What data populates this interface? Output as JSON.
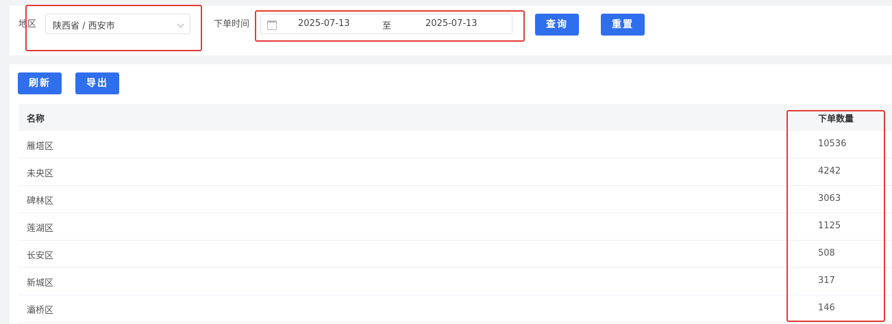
{
  "filters": {
    "region_label": "地区",
    "region_value": "陕西省 / 西安市",
    "order_time_label": "下单时间",
    "date_start": "2025-07-13",
    "date_separator": "至",
    "date_end": "2025-07-13",
    "query_button": "查询",
    "reset_button": "重置"
  },
  "toolbar": {
    "refresh_button": "刷新",
    "export_button": "导出"
  },
  "table": {
    "columns": [
      "名称",
      "下单数量"
    ],
    "rows": [
      {
        "name": "雁塔区",
        "count": "10536"
      },
      {
        "name": "未央区",
        "count": "4242"
      },
      {
        "name": "碑林区",
        "count": "3063"
      },
      {
        "name": "莲湖区",
        "count": "1125"
      },
      {
        "name": "长安区",
        "count": "508"
      },
      {
        "name": "新城区",
        "count": "317"
      },
      {
        "name": "灞桥区",
        "count": "146"
      }
    ]
  },
  "colors": {
    "primary": "#2f6fed",
    "highlight": "#e53935"
  },
  "icons": {
    "calendar": "calendar-icon",
    "dropdown": "chevron-down-icon"
  }
}
